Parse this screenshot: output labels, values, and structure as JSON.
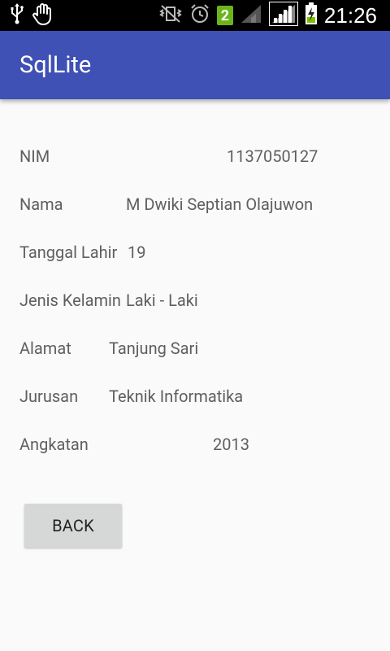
{
  "status_bar": {
    "time": "21:26",
    "notification_count": "2"
  },
  "app_bar": {
    "title": "SqlLite",
    "color": "#3f51b5"
  },
  "details": [
    {
      "label": "NIM",
      "value": "1137050127"
    },
    {
      "label": "Nama",
      "value": "M Dwiki Septian Olajuwon"
    },
    {
      "label": "Tanggal Lahir",
      "value": "19"
    },
    {
      "label": "Jenis Kelamin",
      "value": "Laki - Laki"
    },
    {
      "label": "Alamat",
      "value": "Tanjung Sari"
    },
    {
      "label": "Jurusan",
      "value": "Teknik Informatika"
    },
    {
      "label": "Angkatan",
      "value": "2013"
    }
  ],
  "back_button": {
    "label": "BACK"
  }
}
